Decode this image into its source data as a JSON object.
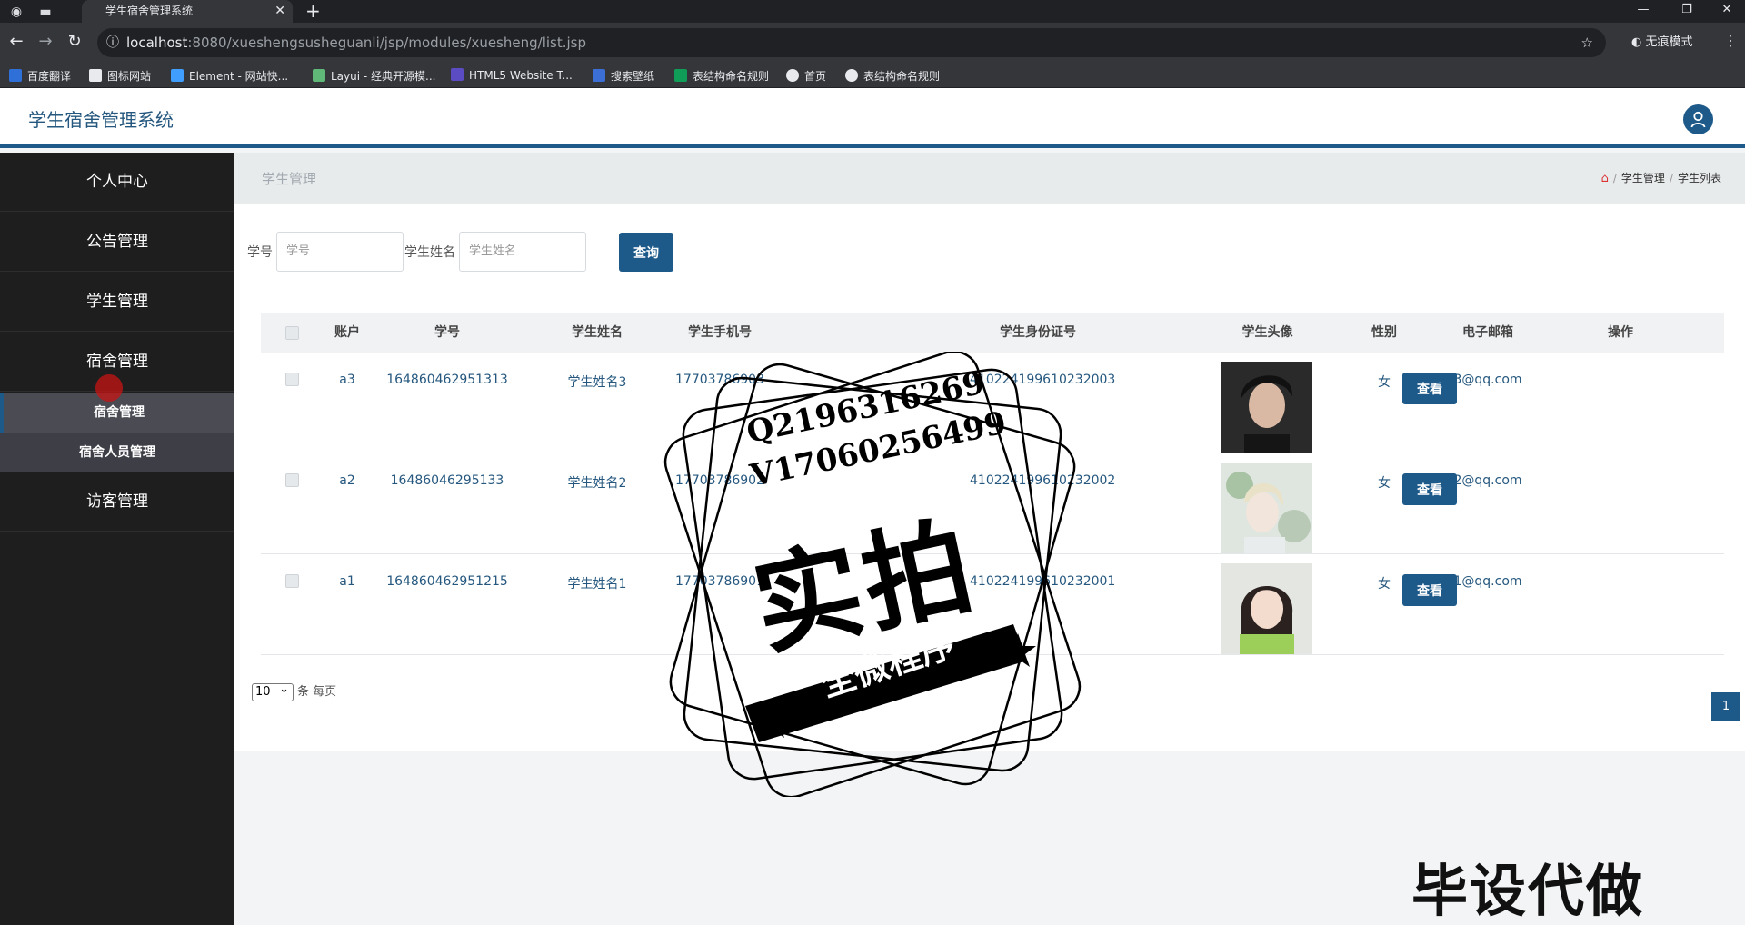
{
  "browser": {
    "tab_title": "学生宿舍管理系统",
    "url_host": "localhost",
    "url_path": ":8080/xueshengsusheguanli/jsp/modules/xuesheng/list.jsp",
    "incognito_label": "无痕模式",
    "bookmarks": [
      {
        "label": "百度翻译",
        "color": "#2f6fd8"
      },
      {
        "label": "图标网站",
        "color": "#ffffff"
      },
      {
        "label": "Element - 网站快...",
        "color": "#409eff"
      },
      {
        "label": "Layui - 经典开源模...",
        "color": "#5fb878"
      },
      {
        "label": "HTML5 Website T...",
        "color": "#5b4cc4"
      },
      {
        "label": "搜索壁纸",
        "color": "#3b6fd6"
      },
      {
        "label": "表结构命名规则",
        "color": "#0f9d58"
      },
      {
        "label": "首页",
        "color": "#e8eaed"
      },
      {
        "label": "表结构命名规则",
        "color": "#e8eaed"
      }
    ]
  },
  "app": {
    "brand": "学生宿舍管理系统"
  },
  "sidebar": {
    "items": [
      {
        "label": "个人中心"
      },
      {
        "label": "公告管理"
      },
      {
        "label": "学生管理"
      },
      {
        "label": "宿舍管理"
      },
      {
        "label": "访客管理"
      }
    ],
    "subitems": [
      {
        "label": "宿舍管理"
      },
      {
        "label": "宿舍人员管理"
      }
    ]
  },
  "breadcrumb": {
    "title": "学生管理",
    "path": [
      "学生管理",
      "学生列表"
    ]
  },
  "search": {
    "id_label": "学号",
    "id_placeholder": "学号",
    "name_label": "学生姓名",
    "name_placeholder": "学生姓名",
    "button": "查询"
  },
  "table": {
    "headers": [
      "账户",
      "学号",
      "学生姓名",
      "学生手机号",
      "学生身份证号",
      "学生头像",
      "性别",
      "电子邮箱",
      "操作"
    ],
    "rows": [
      {
        "account": "a3",
        "student_no": "16486046295131​3",
        "name": "学生姓名3",
        "phone": "17703786903",
        "idcard": "410224199610232003",
        "gender": "女",
        "email": "3@qq.com",
        "action": "查看"
      },
      {
        "account": "a2",
        "student_no": "16486046295133",
        "name": "学生姓名2",
        "phone": "17703786902",
        "idcard": "410224199610232002",
        "gender": "女",
        "email": "2@qq.com",
        "action": "查看"
      },
      {
        "account": "a1",
        "student_no": "164860462951215",
        "name": "学生姓名1",
        "phone": "17703786901",
        "idcard": "410224199610232001",
        "gender": "女",
        "email": "1@qq.com",
        "action": "查看"
      }
    ]
  },
  "pager": {
    "size": "10",
    "suffix": "条 每页",
    "current": "1"
  },
  "watermark": {
    "line1": "Q2196316269",
    "line2": "V17060256499",
    "big": "实拍",
    "ribbon": "全微程序",
    "corner": "毕设代做"
  }
}
